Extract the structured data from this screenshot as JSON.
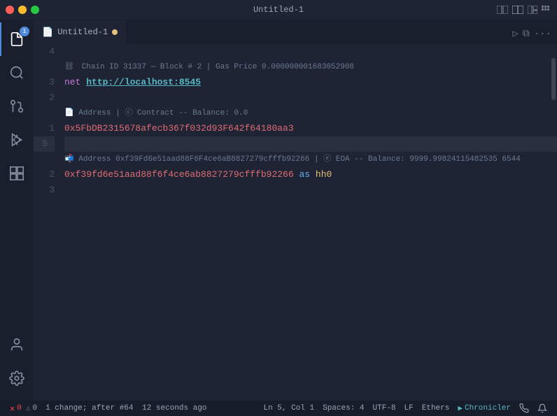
{
  "titlebar": {
    "title": "Untitled-1",
    "traffic_lights": [
      "close",
      "minimize",
      "maximize"
    ]
  },
  "tabs": [
    {
      "label": "Untitled-1",
      "modified": true,
      "active": true
    }
  ],
  "editor": {
    "lines": [
      {
        "num": "4",
        "type": "empty",
        "content": ""
      },
      {
        "num": "",
        "type": "deco",
        "icon": "⛓",
        "content": " Chain ID 31337 — Block # 2 | Gas Price 0.000000001683052908"
      },
      {
        "num": "3",
        "type": "code",
        "content": "net_keyword net_url",
        "keyword": "net",
        "url": "http://localhost:8545"
      },
      {
        "num": "2",
        "type": "empty",
        "content": ""
      },
      {
        "num": "",
        "type": "deco",
        "icon": "📄",
        "content": " Address | ⓒ Contract -- Balance: 0.0"
      },
      {
        "num": "1",
        "type": "code_address",
        "address": "0x5FbDB2315678afecb367f032d93F642f64180aa3"
      },
      {
        "num": "5",
        "type": "empty_highlighted",
        "content": ""
      },
      {
        "num": "",
        "type": "deco2",
        "icon": "📬",
        "content": " Address 0xf39Fd6e51aad88F6F4ce6aB8827279cfffb92266 | ⓔ EOA -- Balance: 9999.99824115482535 6544"
      },
      {
        "num": "2",
        "type": "code_address2",
        "address": "0xf39fd6e51aad88f6f4ce6ab8827279cfffb92266",
        "keyword": "as",
        "varname": "hh0"
      },
      {
        "num": "3",
        "type": "empty",
        "content": ""
      }
    ]
  },
  "statusbar": {
    "errors": "0",
    "warnings": "0",
    "changes": "1 change; after #64",
    "time": "12 seconds ago",
    "position": "Ln 5, Col 1",
    "spaces": "Spaces: 4",
    "encoding": "UTF-8",
    "eol": "LF",
    "language": "Ethers",
    "run_label": "Chronicler",
    "broadcast_label": "",
    "notification_label": ""
  },
  "icons": {
    "files": "📄",
    "search": "🔍",
    "git": "⎇",
    "debug": "▶",
    "extensions": "⊞",
    "account": "👤",
    "settings": "⚙"
  }
}
